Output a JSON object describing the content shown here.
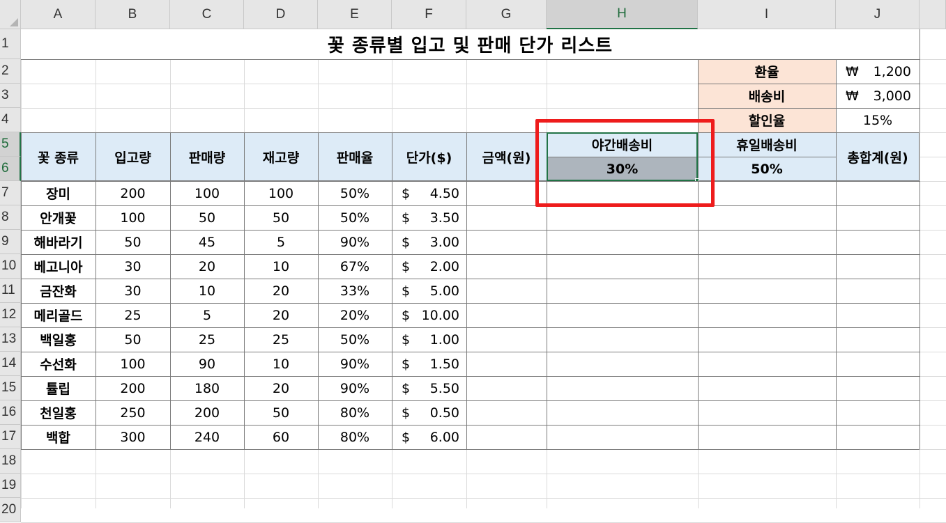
{
  "columns": [
    "A",
    "B",
    "C",
    "D",
    "E",
    "F",
    "G",
    "H",
    "I",
    "J"
  ],
  "rows": [
    "1",
    "2",
    "3",
    "4",
    "5",
    "6",
    "7",
    "8",
    "9",
    "10",
    "11",
    "12",
    "13",
    "14",
    "15",
    "16",
    "17",
    "18",
    "19",
    "20"
  ],
  "title": "꽃 종류별 입고 및 판매 단가 리스트",
  "settings": {
    "exchange_label": "환율",
    "exchange_symbol": "₩",
    "exchange_value": "1,200",
    "shipping_label": "배송비",
    "shipping_symbol": "₩",
    "shipping_value": "3,000",
    "discount_label": "할인율",
    "discount_value": "15%"
  },
  "headers": {
    "flower": "꽃 종류",
    "inbound": "입고량",
    "sold": "판매량",
    "stock": "재고량",
    "rate": "판매율",
    "price": "단가($)",
    "amount": "금액(원)",
    "night": "야간배송비",
    "night_rate": "30%",
    "holiday": "휴일배송비",
    "holiday_rate": "50%",
    "total": "총합계(원)"
  },
  "table": [
    {
      "name": "장미",
      "inbound": "200",
      "sold": "100",
      "stock": "100",
      "rate": "50%",
      "cur": "$",
      "price": "4.50"
    },
    {
      "name": "안개꽃",
      "inbound": "100",
      "sold": "50",
      "stock": "50",
      "rate": "50%",
      "cur": "$",
      "price": "3.50"
    },
    {
      "name": "해바라기",
      "inbound": "50",
      "sold": "45",
      "stock": "5",
      "rate": "90%",
      "cur": "$",
      "price": "3.00"
    },
    {
      "name": "베고니아",
      "inbound": "30",
      "sold": "20",
      "stock": "10",
      "rate": "67%",
      "cur": "$",
      "price": "2.00"
    },
    {
      "name": "금잔화",
      "inbound": "30",
      "sold": "10",
      "stock": "20",
      "rate": "33%",
      "cur": "$",
      "price": "5.00"
    },
    {
      "name": "메리골드",
      "inbound": "25",
      "sold": "5",
      "stock": "20",
      "rate": "20%",
      "cur": "$",
      "price": "10.00"
    },
    {
      "name": "백일홍",
      "inbound": "50",
      "sold": "25",
      "stock": "25",
      "rate": "50%",
      "cur": "$",
      "price": "1.00"
    },
    {
      "name": "수선화",
      "inbound": "100",
      "sold": "90",
      "stock": "10",
      "rate": "90%",
      "cur": "$",
      "price": "1.50"
    },
    {
      "name": "튤립",
      "inbound": "200",
      "sold": "180",
      "stock": "20",
      "rate": "90%",
      "cur": "$",
      "price": "5.50"
    },
    {
      "name": "천일홍",
      "inbound": "250",
      "sold": "200",
      "stock": "50",
      "rate": "80%",
      "cur": "$",
      "price": "0.50"
    },
    {
      "name": "백합",
      "inbound": "300",
      "sold": "240",
      "stock": "60",
      "rate": "80%",
      "cur": "$",
      "price": "6.00"
    }
  ],
  "colors": {
    "header_fill": "#ddebf7",
    "settings_fill": "#fce4d6",
    "selected_fill": "#adb5bd",
    "highlight_box": "#ee1c1c",
    "selection": "#217346"
  }
}
